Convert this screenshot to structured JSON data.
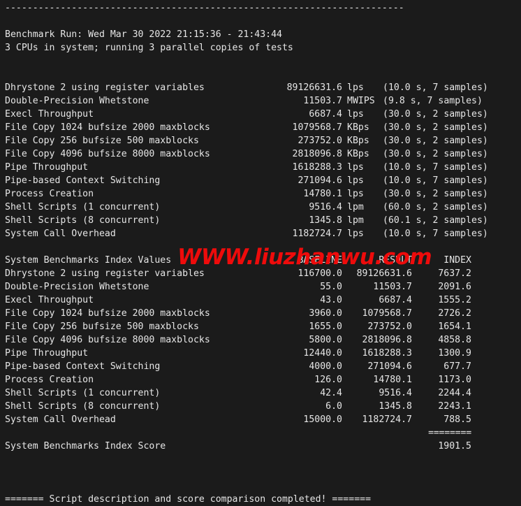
{
  "terminal": {
    "background_color": "#1b1b1b",
    "text_color": "#e6e6e6",
    "divider_top": "------------------------------------------------------------------------",
    "run_header": "Benchmark Run: Wed Mar 30 2022 21:15:36 - 21:43:44",
    "cpu_line": "3 CPUs in system; running 3 parallel copies of tests",
    "footer": "======= Script description and score comparison completed! ======="
  },
  "watermark": {
    "text": "WWW.liuzhanwu.com",
    "color": "#ee0b0b"
  },
  "results": {
    "rows": [
      {
        "label": "Dhrystone 2 using register variables",
        "value": "89126631.6",
        "unit": "lps",
        "samples": "(10.0 s, 7 samples)"
      },
      {
        "label": "Double-Precision Whetstone",
        "value": "11503.7",
        "unit": "MWIPS",
        "samples": "(9.8 s, 7 samples)"
      },
      {
        "label": "Execl Throughput",
        "value": "6687.4",
        "unit": "lps",
        "samples": "(30.0 s, 2 samples)"
      },
      {
        "label": "File Copy 1024 bufsize 2000 maxblocks",
        "value": "1079568.7",
        "unit": "KBps",
        "samples": "(30.0 s, 2 samples)"
      },
      {
        "label": "File Copy 256 bufsize 500 maxblocks",
        "value": "273752.0",
        "unit": "KBps",
        "samples": "(30.0 s, 2 samples)"
      },
      {
        "label": "File Copy 4096 bufsize 8000 maxblocks",
        "value": "2818096.8",
        "unit": "KBps",
        "samples": "(30.0 s, 2 samples)"
      },
      {
        "label": "Pipe Throughput",
        "value": "1618288.3",
        "unit": "lps",
        "samples": "(10.0 s, 7 samples)"
      },
      {
        "label": "Pipe-based Context Switching",
        "value": "271094.6",
        "unit": "lps",
        "samples": "(10.0 s, 7 samples)"
      },
      {
        "label": "Process Creation",
        "value": "14780.1",
        "unit": "lps",
        "samples": "(30.0 s, 2 samples)"
      },
      {
        "label": "Shell Scripts (1 concurrent)",
        "value": "9516.4",
        "unit": "lpm",
        "samples": "(60.0 s, 2 samples)"
      },
      {
        "label": "Shell Scripts (8 concurrent)",
        "value": "1345.8",
        "unit": "lpm",
        "samples": "(60.1 s, 2 samples)"
      },
      {
        "label": "System Call Overhead",
        "value": "1182724.7",
        "unit": "lps",
        "samples": "(10.0 s, 7 samples)"
      }
    ]
  },
  "index_table": {
    "title": "System Benchmarks Index Values",
    "headers": {
      "baseline": "BASELINE",
      "result": "RESULT",
      "index": "INDEX"
    },
    "rows": [
      {
        "label": "Dhrystone 2 using register variables",
        "baseline": "116700.0",
        "result": "89126631.6",
        "index": "7637.2"
      },
      {
        "label": "Double-Precision Whetstone",
        "baseline": "55.0",
        "result": "11503.7",
        "index": "2091.6"
      },
      {
        "label": "Execl Throughput",
        "baseline": "43.0",
        "result": "6687.4",
        "index": "1555.2"
      },
      {
        "label": "File Copy 1024 bufsize 2000 maxblocks",
        "baseline": "3960.0",
        "result": "1079568.7",
        "index": "2726.2"
      },
      {
        "label": "File Copy 256 bufsize 500 maxblocks",
        "baseline": "1655.0",
        "result": "273752.0",
        "index": "1654.1"
      },
      {
        "label": "File Copy 4096 bufsize 8000 maxblocks",
        "baseline": "5800.0",
        "result": "2818096.8",
        "index": "4858.8"
      },
      {
        "label": "Pipe Throughput",
        "baseline": "12440.0",
        "result": "1618288.3",
        "index": "1300.9"
      },
      {
        "label": "Pipe-based Context Switching",
        "baseline": "4000.0",
        "result": "271094.6",
        "index": "677.7"
      },
      {
        "label": "Process Creation",
        "baseline": "126.0",
        "result": "14780.1",
        "index": "1173.0"
      },
      {
        "label": "Shell Scripts (1 concurrent)",
        "baseline": "42.4",
        "result": "9516.4",
        "index": "2244.4"
      },
      {
        "label": "Shell Scripts (8 concurrent)",
        "baseline": "6.0",
        "result": "1345.8",
        "index": "2243.1"
      },
      {
        "label": "System Call Overhead",
        "baseline": "15000.0",
        "result": "1182724.7",
        "index": "788.5"
      }
    ],
    "separator": "========",
    "score_label": "System Benchmarks Index Score",
    "score_value": "1901.5"
  }
}
